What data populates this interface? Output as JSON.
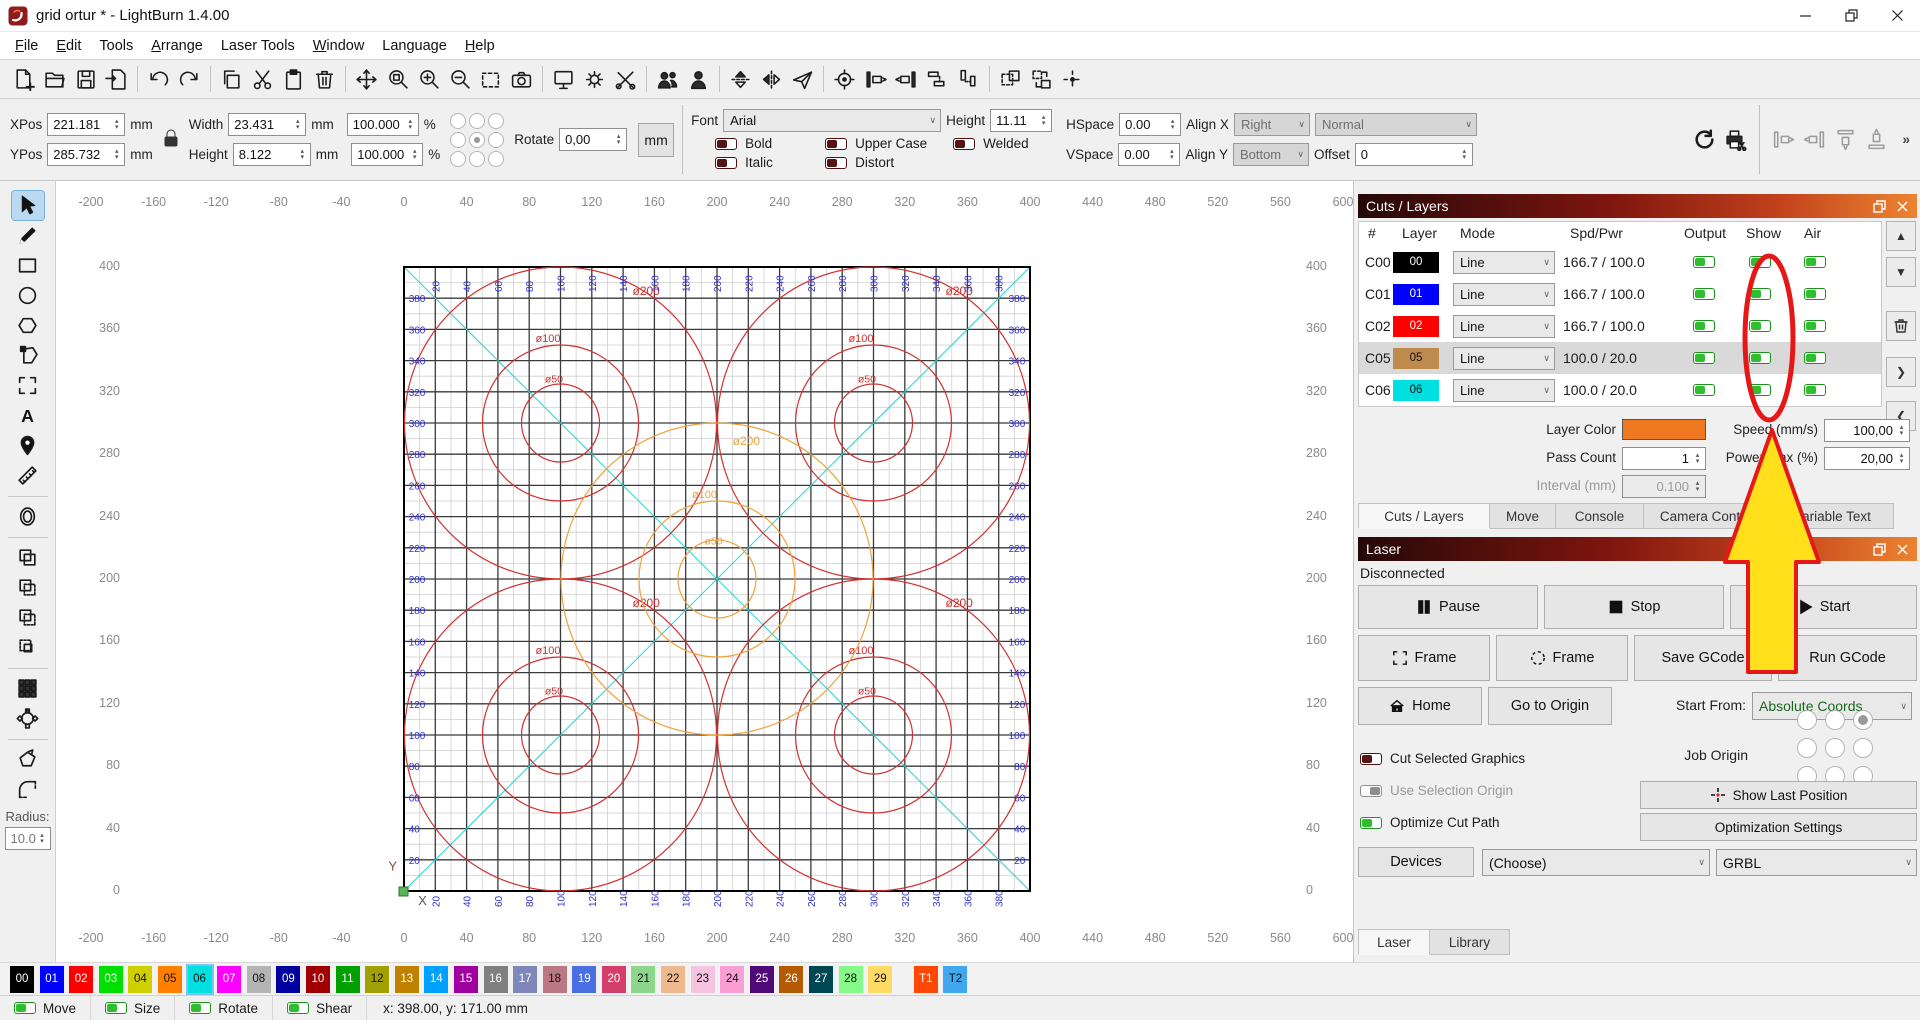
{
  "window": {
    "title": "grid ortur * - LightBurn 1.4.00"
  },
  "menu": {
    "items": [
      {
        "label": "File",
        "u": 0
      },
      {
        "label": "Edit",
        "u": 0
      },
      {
        "label": "Tools",
        "u": -1
      },
      {
        "label": "Arrange",
        "u": 0
      },
      {
        "label": "Laser Tools",
        "u": -1
      },
      {
        "label": "Window",
        "u": 0
      },
      {
        "label": "Language",
        "u": -1
      },
      {
        "label": "Help",
        "u": 0
      }
    ]
  },
  "toolbar_main": {
    "icons": [
      "file-new",
      "file-open",
      "file-save",
      "file-import",
      "sep",
      "undo",
      "redo",
      "sep",
      "copy",
      "cut",
      "paste",
      "delete",
      "sep",
      "pan",
      "zoom-box",
      "zoom-in",
      "zoom-out",
      "marquee",
      "camera",
      "sep",
      "preview-monitor",
      "device-settings-gear",
      "settings-wrench",
      "sep",
      "community-users",
      "user-account",
      "sep",
      "flip-vertical",
      "flip-horizontal",
      "send-airplane",
      "sep",
      "focus-target",
      "align-left",
      "align-right",
      "distribute-h",
      "distribute-v",
      "sep",
      "selection-size",
      "swap-rects",
      "show-position-crosshair"
    ]
  },
  "numeric_toolbar": {
    "xpos_label": "XPos",
    "xpos": "221.181",
    "ypos_label": "YPos",
    "ypos": "285.732",
    "unit_mm": "mm",
    "width_label": "Width",
    "width": "23.431",
    "height_label": "Height",
    "height": "8.122",
    "wpct": "100.000",
    "hpct": "100.000",
    "pct": "%",
    "rotate_label": "Rotate",
    "rotate": "0,00",
    "units_button": "mm"
  },
  "text_toolbar": {
    "font_label": "Font",
    "font": "Arial",
    "height_label": "Height",
    "height": "11.11",
    "bold": "Bold",
    "italic": "Italic",
    "upper": "Upper Case",
    "distort": "Distort",
    "welded": "Welded",
    "hspace_label": "HSpace",
    "hspace": "0.00",
    "vspace_label": "VSpace",
    "vspace": "0.00",
    "alignx_label": "Align X",
    "alignx": "Right",
    "style": "Normal",
    "aligny_label": "Align Y",
    "aligny": "Bottom",
    "offset_label": "Offset",
    "offset": "0",
    "overflow": "»"
  },
  "right_icons": [
    "refresh",
    "print-cut"
  ],
  "gray_icons": [
    "dock-align-1",
    "dock-align-2",
    "dock-align-3",
    "dock-align-4"
  ],
  "left_tools": {
    "icons": [
      "select-tool",
      "draw-lines",
      "rectangle-tool",
      "ellipse-tool",
      "polygon-tool",
      "edit-nodes",
      "edit-frame",
      "text-tool",
      "position-laser",
      "measure-tool",
      "sep",
      "offset-shapes",
      "sep",
      "boolean-union",
      "boolean-subtract",
      "boolean-difference",
      "boolean-intersect",
      "sep",
      "grid-array",
      "circular-array",
      "sep",
      "copy-along-path",
      "radius-fillet"
    ],
    "active": "select-tool",
    "radius_label": "Radius:",
    "radius": "10.0"
  },
  "rulers": {
    "h_values": [
      -200,
      -160,
      -120,
      -80,
      -40,
      0,
      40,
      80,
      120,
      160,
      200,
      240,
      280,
      320,
      360,
      400,
      440,
      480,
      520,
      560,
      600
    ],
    "v_values": [
      400,
      360,
      320,
      280,
      240,
      200,
      160,
      120,
      80,
      40,
      0
    ]
  },
  "canvas": {
    "workspace_mm": 400,
    "grid_minor_mm": 10,
    "grid_major_mm": 20,
    "edge_step": 20,
    "edge_max": 380,
    "red_groups": [
      [
        100,
        300
      ],
      [
        300,
        300
      ],
      [
        100,
        100
      ],
      [
        300,
        100
      ]
    ],
    "group_radii": [
      100,
      50,
      25
    ],
    "orange_group": [
      200,
      200
    ],
    "diam_labels": [
      "ø200",
      "ø100",
      "ø50"
    ],
    "diagonals": [
      [
        0,
        0,
        400,
        400
      ],
      [
        0,
        400,
        400,
        0
      ]
    ],
    "x_label": "X",
    "y_label": "Y",
    "colors": {
      "red": "#d03030",
      "orange": "#eea23c",
      "blue": "#2f2fd0",
      "cyan": "#35d6d6",
      "grid_major": "#3a3a3a",
      "grid_minor": "#cfcfcf",
      "border": "#000000",
      "origin": "#58b558"
    }
  },
  "cuts_panel": {
    "title": "Cuts / Layers",
    "headers": {
      "num": "#",
      "layer": "Layer",
      "mode": "Mode",
      "spd": "Spd/Pwr",
      "output": "Output",
      "show": "Show",
      "air": "Air"
    },
    "rows": [
      {
        "id": "C00",
        "num": "00",
        "color": "#000000",
        "mode": "Line",
        "spd": "166.7 / 100.0",
        "selected": false
      },
      {
        "id": "C01",
        "num": "01",
        "color": "#0000ff",
        "mode": "Line",
        "spd": "166.7 / 100.0",
        "selected": false
      },
      {
        "id": "C02",
        "num": "02",
        "color": "#ff0000",
        "mode": "Line",
        "spd": "166.7 / 100.0",
        "selected": false
      },
      {
        "id": "C05",
        "num": "05",
        "color": "#bf8a4d",
        "mode": "Line",
        "spd": "100.0 / 20.0",
        "selected": true
      },
      {
        "id": "C06",
        "num": "06",
        "color": "#00e0e0",
        "mode": "Line",
        "spd": "100.0 / 20.0",
        "selected": false
      }
    ],
    "layer_color_label": "Layer Color",
    "layer_color": "#f07820",
    "speed_label": "Speed (mm/s)",
    "speed": "100,00",
    "pass_label": "Pass Count",
    "pass": "1",
    "power_label": "Power Max (%)",
    "power": "20,00",
    "interval_label": "Interval (mm)",
    "interval": "0.100",
    "tabs": [
      "Cuts / Layers",
      "Move",
      "Console",
      "Camera Control",
      "Variable Text"
    ]
  },
  "laser_panel": {
    "title": "Laser",
    "status": "Disconnected",
    "pause": "Pause",
    "stop": "Stop",
    "start": "Start",
    "frame_rect": "Frame",
    "frame_circle": "Frame",
    "save_gcode": "Save GCode",
    "run_gcode": "Run GCode",
    "home": "Home",
    "goto_origin": "Go to Origin",
    "start_from_label": "Start From:",
    "start_from": "Absolute Coords",
    "job_origin_label": "Job Origin",
    "cut_selected": "Cut Selected Graphics",
    "use_sel_origin": "Use Selection Origin",
    "optimize": "Optimize Cut Path",
    "show_last": "Show Last Position",
    "opt_settings": "Optimization Settings",
    "devices": "Devices",
    "choose": "(Choose)",
    "firmware": "GRBL",
    "tabs": [
      "Laser",
      "Library"
    ]
  },
  "palette": {
    "selected": "06",
    "chips": [
      {
        "id": "00",
        "color": "#000000"
      },
      {
        "id": "01",
        "color": "#0000ff"
      },
      {
        "id": "02",
        "color": "#ff0000"
      },
      {
        "id": "03",
        "color": "#00e000"
      },
      {
        "id": "04",
        "color": "#d0d000"
      },
      {
        "id": "05",
        "color": "#ff8000"
      },
      {
        "id": "06",
        "color": "#00e0e0"
      },
      {
        "id": "07",
        "color": "#ff00ff"
      },
      {
        "id": "08",
        "color": "#b4b4b4"
      },
      {
        "id": "09",
        "color": "#0000a0"
      },
      {
        "id": "10",
        "color": "#a00000"
      },
      {
        "id": "11",
        "color": "#00a000"
      },
      {
        "id": "12",
        "color": "#a0a000"
      },
      {
        "id": "13",
        "color": "#c08000"
      },
      {
        "id": "14",
        "color": "#00a0ff"
      },
      {
        "id": "15",
        "color": "#a000a0"
      },
      {
        "id": "16",
        "color": "#808080"
      },
      {
        "id": "17",
        "color": "#7d87b9"
      },
      {
        "id": "18",
        "color": "#bb7784"
      },
      {
        "id": "19",
        "color": "#4a6fe3"
      },
      {
        "id": "20",
        "color": "#d33f6a"
      },
      {
        "id": "21",
        "color": "#8cd78c"
      },
      {
        "id": "22",
        "color": "#f0b98d"
      },
      {
        "id": "23",
        "color": "#f6c4e1"
      },
      {
        "id": "24",
        "color": "#fa9ed4"
      },
      {
        "id": "25",
        "color": "#500a78"
      },
      {
        "id": "26",
        "color": "#b45a00"
      },
      {
        "id": "27",
        "color": "#004754"
      },
      {
        "id": "28",
        "color": "#86fa88"
      },
      {
        "id": "29",
        "color": "#ffdb66"
      },
      {
        "id": "T1",
        "color": "#ff4806"
      },
      {
        "id": "T2",
        "color": "#41a8f0"
      }
    ]
  },
  "statusbar": {
    "toggles": [
      "Move",
      "Size",
      "Rotate",
      "Shear"
    ],
    "coords": "x: 398.00, y: 171.00 mm"
  },
  "annotation": {
    "arrow_fill": "#ffe01a",
    "stroke": "#e61717"
  },
  "colors": {
    "toggle_on": "#2ebf2e",
    "selection_row": "#d9d9d9",
    "title_gradient": [
      "#250808",
      "#7e150e",
      "#ec8430"
    ]
  }
}
